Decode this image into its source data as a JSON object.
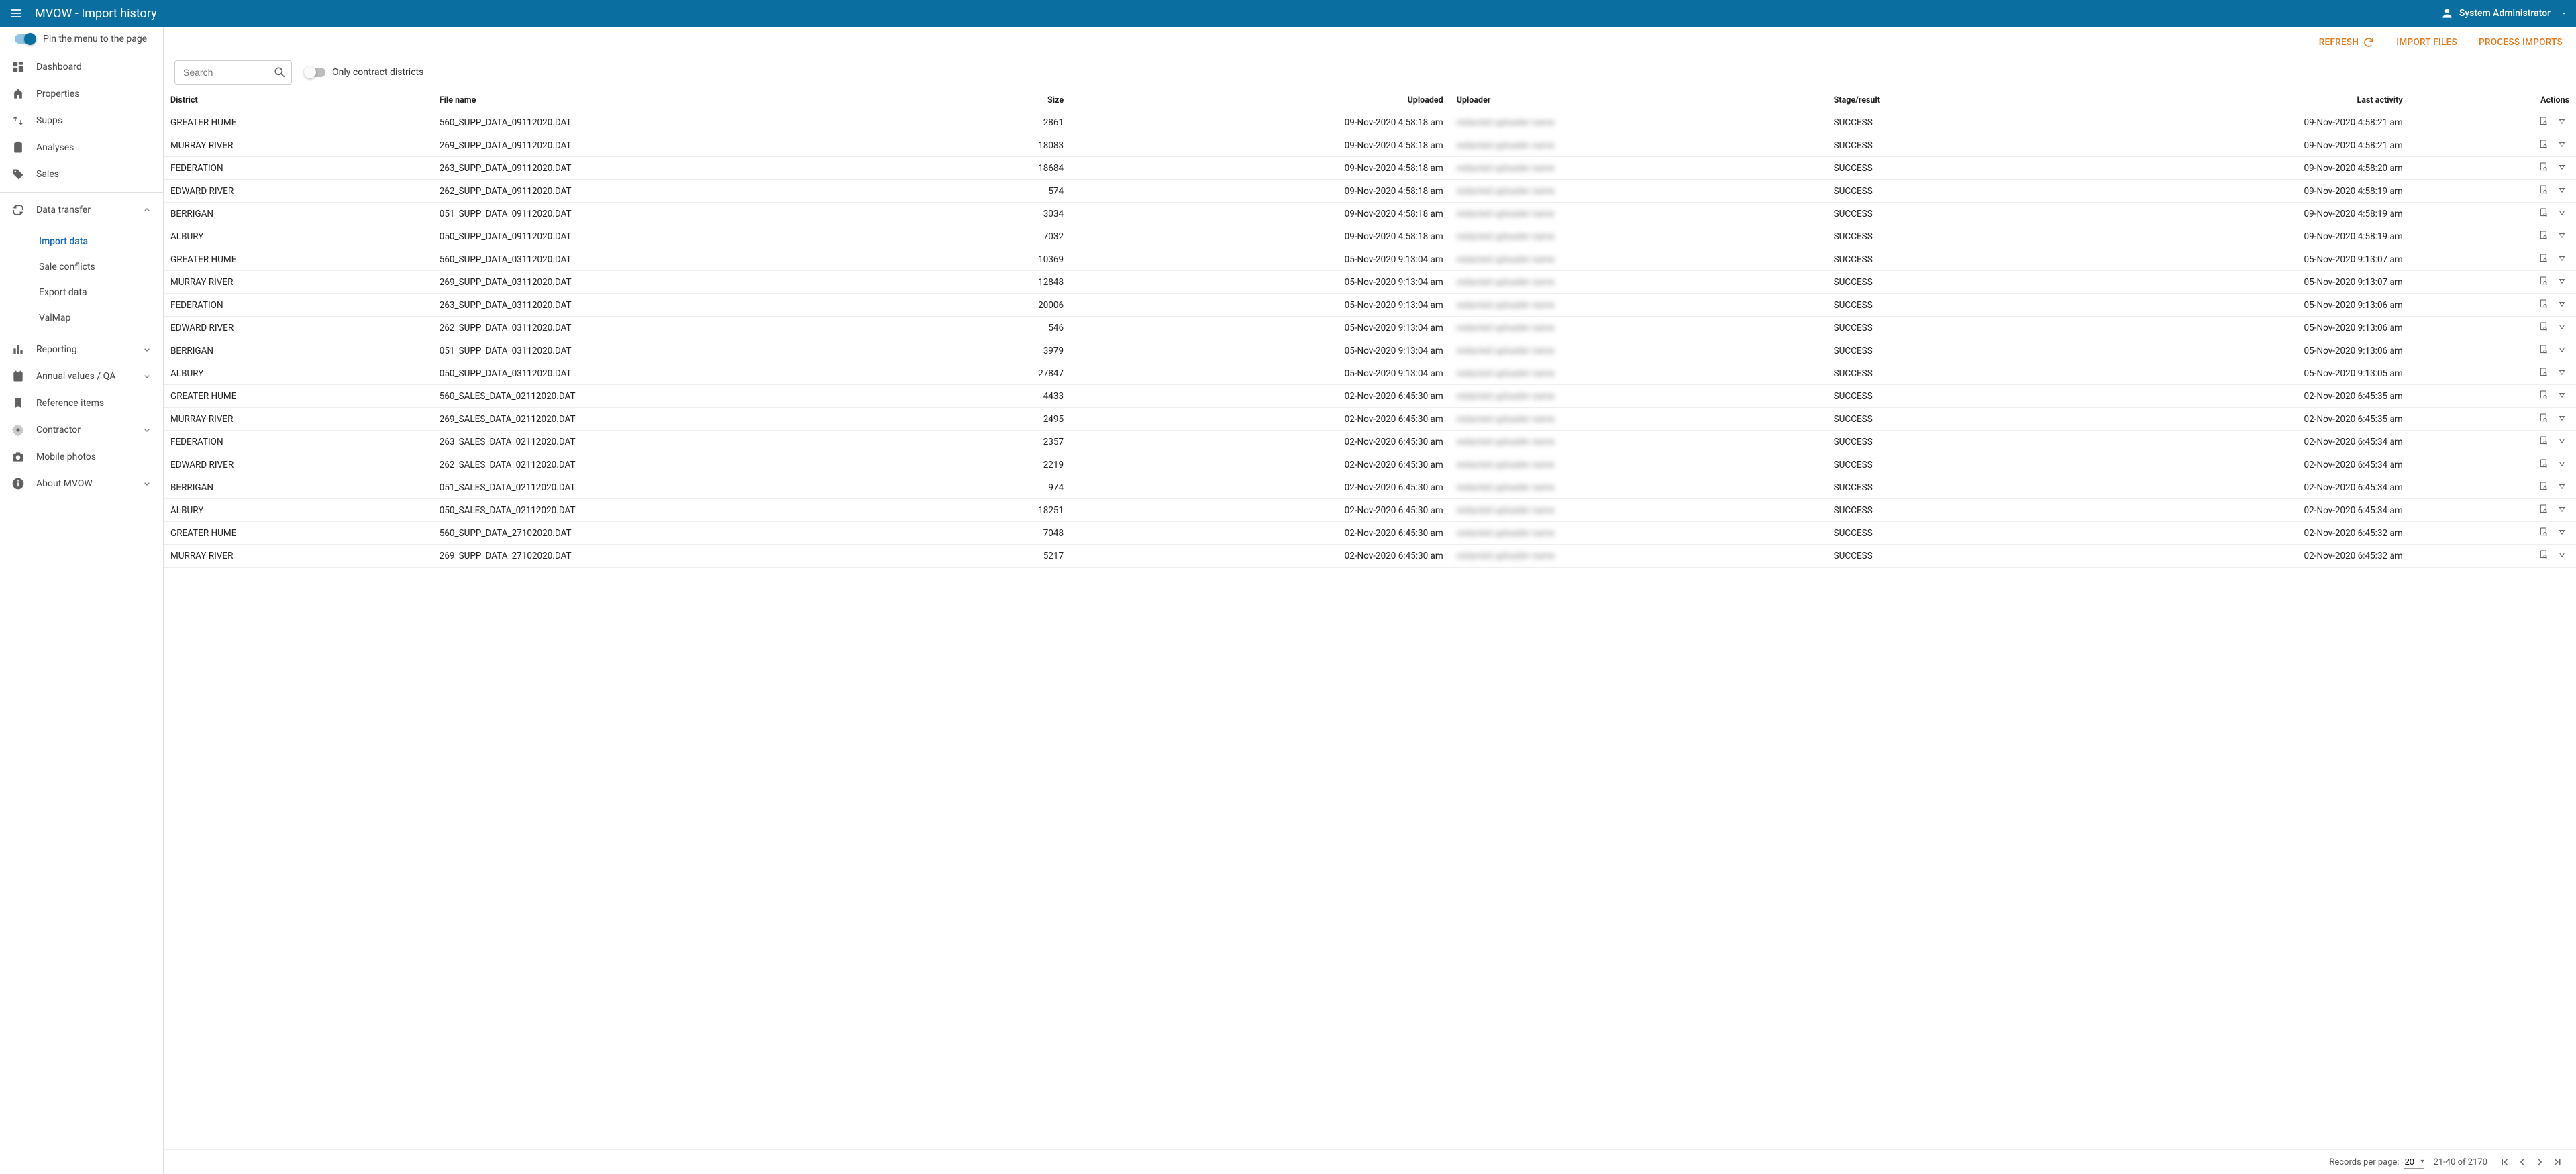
{
  "appbar": {
    "title": "MVOW - Import history",
    "user": "System Administrator"
  },
  "sidebar": {
    "pin_label": "Pin the menu to the page",
    "items": [
      {
        "icon": "dashboard",
        "label": "Dashboard"
      },
      {
        "icon": "home",
        "label": "Properties"
      },
      {
        "icon": "swap",
        "label": "Supps"
      },
      {
        "icon": "assignment",
        "label": "Analyses"
      },
      {
        "icon": "tag",
        "label": "Sales"
      }
    ],
    "data_transfer": {
      "icon": "transfer",
      "label": "Data transfer",
      "children": [
        {
          "label": "Import data",
          "active": true
        },
        {
          "label": "Sale conflicts"
        },
        {
          "label": "Export data"
        },
        {
          "label": "ValMap"
        }
      ]
    },
    "items2": [
      {
        "icon": "bar",
        "label": "Reporting",
        "chev": true
      },
      {
        "icon": "calendar",
        "label": "Annual values / QA",
        "chev": true
      },
      {
        "icon": "bookmark",
        "label": "Reference items"
      },
      {
        "icon": "gear",
        "label": "Contractor",
        "chev": true
      },
      {
        "icon": "camera",
        "label": "Mobile photos"
      },
      {
        "icon": "info",
        "label": "About MVOW",
        "chev": true
      }
    ]
  },
  "toolbar": {
    "refresh": "REFRESH",
    "import_files": "IMPORT FILES",
    "process_imports": "PROCESS IMPORTS"
  },
  "filter": {
    "search_placeholder": "Search",
    "only_contract": "Only contract districts"
  },
  "columns": {
    "district": "District",
    "file": "File name",
    "size": "Size",
    "uploaded": "Uploaded",
    "uploader": "Uploader",
    "stage": "Stage/result",
    "last": "Last activity",
    "actions": "Actions"
  },
  "rows": [
    {
      "district": "GREATER HUME",
      "file": "560_SUPP_DATA_09112020.DAT",
      "size": "2861",
      "uploaded": "09-Nov-2020 4:58:18 am",
      "stage": "SUCCESS",
      "last": "09-Nov-2020 4:58:21 am"
    },
    {
      "district": "MURRAY RIVER",
      "file": "269_SUPP_DATA_09112020.DAT",
      "size": "18083",
      "uploaded": "09-Nov-2020 4:58:18 am",
      "stage": "SUCCESS",
      "last": "09-Nov-2020 4:58:21 am"
    },
    {
      "district": "FEDERATION",
      "file": "263_SUPP_DATA_09112020.DAT",
      "size": "18684",
      "uploaded": "09-Nov-2020 4:58:18 am",
      "stage": "SUCCESS",
      "last": "09-Nov-2020 4:58:20 am"
    },
    {
      "district": "EDWARD RIVER",
      "file": "262_SUPP_DATA_09112020.DAT",
      "size": "574",
      "uploaded": "09-Nov-2020 4:58:18 am",
      "stage": "SUCCESS",
      "last": "09-Nov-2020 4:58:19 am"
    },
    {
      "district": "BERRIGAN",
      "file": "051_SUPP_DATA_09112020.DAT",
      "size": "3034",
      "uploaded": "09-Nov-2020 4:58:18 am",
      "stage": "SUCCESS",
      "last": "09-Nov-2020 4:58:19 am"
    },
    {
      "district": "ALBURY",
      "file": "050_SUPP_DATA_09112020.DAT",
      "size": "7032",
      "uploaded": "09-Nov-2020 4:58:18 am",
      "stage": "SUCCESS",
      "last": "09-Nov-2020 4:58:19 am"
    },
    {
      "district": "GREATER HUME",
      "file": "560_SUPP_DATA_03112020.DAT",
      "size": "10369",
      "uploaded": "05-Nov-2020 9:13:04 am",
      "stage": "SUCCESS",
      "last": "05-Nov-2020 9:13:07 am"
    },
    {
      "district": "MURRAY RIVER",
      "file": "269_SUPP_DATA_03112020.DAT",
      "size": "12848",
      "uploaded": "05-Nov-2020 9:13:04 am",
      "stage": "SUCCESS",
      "last": "05-Nov-2020 9:13:07 am"
    },
    {
      "district": "FEDERATION",
      "file": "263_SUPP_DATA_03112020.DAT",
      "size": "20006",
      "uploaded": "05-Nov-2020 9:13:04 am",
      "stage": "SUCCESS",
      "last": "05-Nov-2020 9:13:06 am"
    },
    {
      "district": "EDWARD RIVER",
      "file": "262_SUPP_DATA_03112020.DAT",
      "size": "546",
      "uploaded": "05-Nov-2020 9:13:04 am",
      "stage": "SUCCESS",
      "last": "05-Nov-2020 9:13:06 am"
    },
    {
      "district": "BERRIGAN",
      "file": "051_SUPP_DATA_03112020.DAT",
      "size": "3979",
      "uploaded": "05-Nov-2020 9:13:04 am",
      "stage": "SUCCESS",
      "last": "05-Nov-2020 9:13:06 am"
    },
    {
      "district": "ALBURY",
      "file": "050_SUPP_DATA_03112020.DAT",
      "size": "27847",
      "uploaded": "05-Nov-2020 9:13:04 am",
      "stage": "SUCCESS",
      "last": "05-Nov-2020 9:13:05 am"
    },
    {
      "district": "GREATER HUME",
      "file": "560_SALES_DATA_02112020.DAT",
      "size": "4433",
      "uploaded": "02-Nov-2020 6:45:30 am",
      "stage": "SUCCESS",
      "last": "02-Nov-2020 6:45:35 am"
    },
    {
      "district": "MURRAY RIVER",
      "file": "269_SALES_DATA_02112020.DAT",
      "size": "2495",
      "uploaded": "02-Nov-2020 6:45:30 am",
      "stage": "SUCCESS",
      "last": "02-Nov-2020 6:45:35 am"
    },
    {
      "district": "FEDERATION",
      "file": "263_SALES_DATA_02112020.DAT",
      "size": "2357",
      "uploaded": "02-Nov-2020 6:45:30 am",
      "stage": "SUCCESS",
      "last": "02-Nov-2020 6:45:34 am"
    },
    {
      "district": "EDWARD RIVER",
      "file": "262_SALES_DATA_02112020.DAT",
      "size": "2219",
      "uploaded": "02-Nov-2020 6:45:30 am",
      "stage": "SUCCESS",
      "last": "02-Nov-2020 6:45:34 am"
    },
    {
      "district": "BERRIGAN",
      "file": "051_SALES_DATA_02112020.DAT",
      "size": "974",
      "uploaded": "02-Nov-2020 6:45:30 am",
      "stage": "SUCCESS",
      "last": "02-Nov-2020 6:45:34 am"
    },
    {
      "district": "ALBURY",
      "file": "050_SALES_DATA_02112020.DAT",
      "size": "18251",
      "uploaded": "02-Nov-2020 6:45:30 am",
      "stage": "SUCCESS",
      "last": "02-Nov-2020 6:45:34 am"
    },
    {
      "district": "GREATER HUME",
      "file": "560_SUPP_DATA_27102020.DAT",
      "size": "7048",
      "uploaded": "02-Nov-2020 6:45:30 am",
      "stage": "SUCCESS",
      "last": "02-Nov-2020 6:45:32 am"
    },
    {
      "district": "MURRAY RIVER",
      "file": "269_SUPP_DATA_27102020.DAT",
      "size": "5217",
      "uploaded": "02-Nov-2020 6:45:30 am",
      "stage": "SUCCESS",
      "last": "02-Nov-2020 6:45:32 am"
    }
  ],
  "pagination": {
    "per_page_label": "Records per page:",
    "per_page_value": "20",
    "range": "21-40 of 2170"
  }
}
